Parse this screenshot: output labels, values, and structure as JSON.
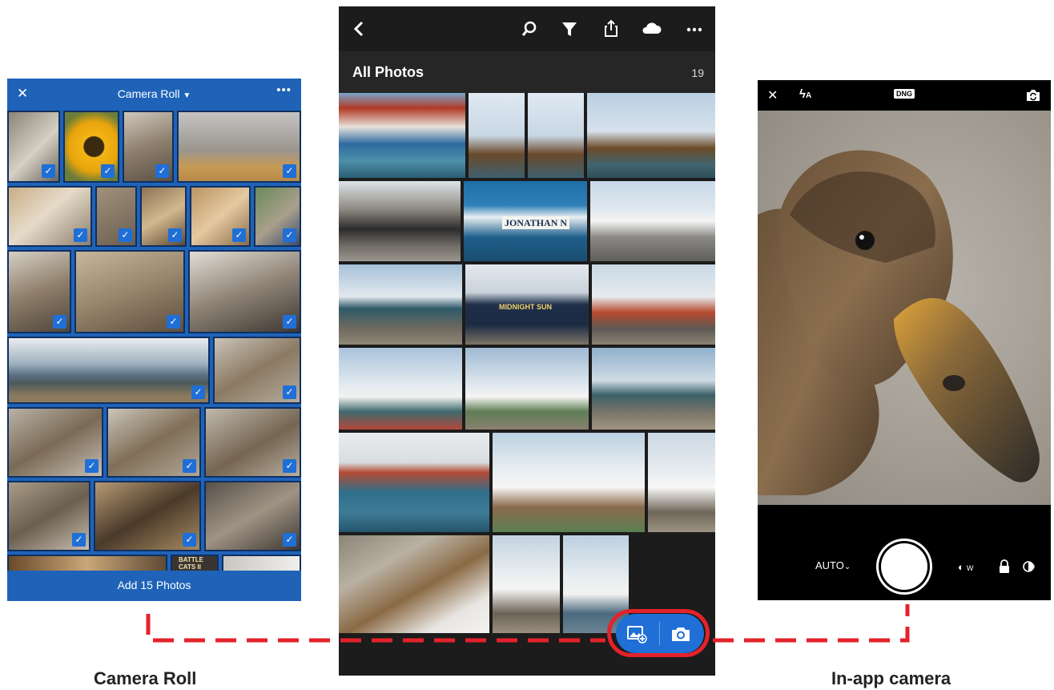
{
  "camera_roll": {
    "close_label": "✕",
    "title": "Camera Roll",
    "more_label": "•••",
    "footer_button": "Add 15 Photos",
    "thumb_labels": [
      "BATTLE",
      "CATS II"
    ]
  },
  "lightroom": {
    "section_title": "All Photos",
    "count": "19",
    "boat_name": "JONATHAN N",
    "boat_name2": "MIDNIGHT SUN"
  },
  "camera": {
    "close_label": "✕",
    "flash_label": "A",
    "format_badge": "DNG",
    "mode_label": "AUTO",
    "wb_label": "W"
  },
  "captions": {
    "camera_roll": "Camera Roll",
    "in_app_camera": "In-app camera"
  },
  "colors": {
    "accent_blue": "#1f6fd6",
    "panel_blue": "#1f63b8",
    "highlight_red": "#e4222b"
  }
}
